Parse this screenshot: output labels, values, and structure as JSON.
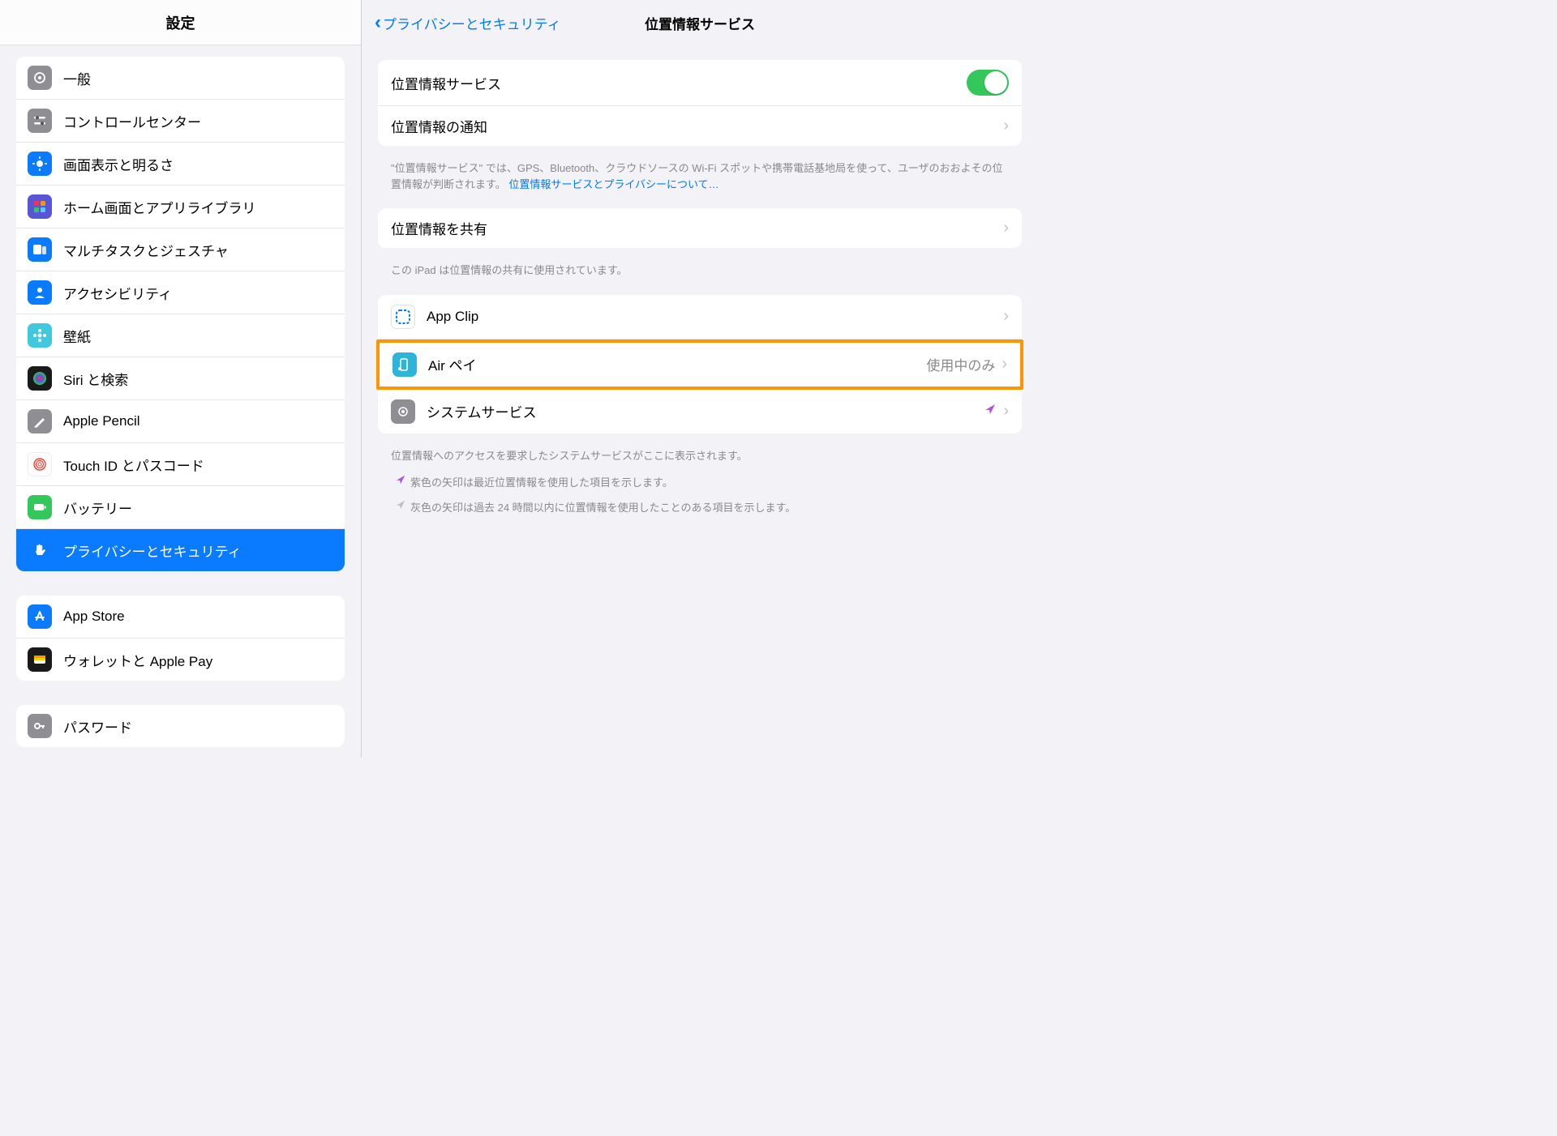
{
  "sidebar": {
    "title": "設定",
    "group1": [
      {
        "label": "一般",
        "color": "#8e8e93",
        "icon": "gear"
      },
      {
        "label": "コントロールセンター",
        "color": "#8e8e93",
        "icon": "sliders"
      },
      {
        "label": "画面表示と明るさ",
        "color": "#0a7aff",
        "icon": "sun"
      },
      {
        "label": "ホーム画面とアプリライブラリ",
        "color": "#5856d6",
        "icon": "grid"
      },
      {
        "label": "マルチタスクとジェスチャ",
        "color": "#0a7aff",
        "icon": "multitask"
      },
      {
        "label": "アクセシビリティ",
        "color": "#0a7aff",
        "icon": "person"
      },
      {
        "label": "壁紙",
        "color": "#3fc8de",
        "icon": "flower"
      },
      {
        "label": "Siri と検索",
        "color": "#1a1a1a",
        "icon": "siri"
      },
      {
        "label": "Apple Pencil",
        "color": "#8e8e93",
        "icon": "pencil"
      },
      {
        "label": "Touch ID とパスコード",
        "color": "#ffffff",
        "icon": "touchid"
      },
      {
        "label": "バッテリー",
        "color": "#34c759",
        "icon": "battery"
      },
      {
        "label": "プライバシーとセキュリティ",
        "color": "#0a7aff",
        "icon": "hand",
        "selected": true
      }
    ],
    "group2": [
      {
        "label": "App Store",
        "color": "#0a7aff",
        "icon": "appstore"
      },
      {
        "label": "ウォレットと Apple Pay",
        "color": "#1a1a1a",
        "icon": "wallet"
      }
    ],
    "group3": [
      {
        "label": "パスワード",
        "color": "#8e8e93",
        "icon": "key"
      }
    ]
  },
  "main": {
    "back": "プライバシーとセキュリティ",
    "title": "位置情報サービス",
    "rows1_a": "位置情報サービス",
    "rows1_b": "位置情報の通知",
    "foot1_text": "\"位置情報サービス\" では、GPS、Bluetooth、クラウドソースの Wi-Fi スポットや携帯電話基地局を使って、ユーザのおおよその位置情報が判断されます。 ",
    "foot1_link": "位置情報サービスとプライバシーについて…",
    "rows2_a": "位置情報を共有",
    "foot2": "この iPad は位置情報の共有に使用されています。",
    "apps": {
      "appclip": "App Clip",
      "airpay": "Air ペイ",
      "airpay_status": "使用中のみ",
      "system": "システムサービス"
    },
    "foot3": "位置情報へのアクセスを要求したシステムサービスがここに表示されます。",
    "legend1": "紫色の矢印は最近位置情報を使用した項目を示します。",
    "legend2": "灰色の矢印は過去 24 時間以内に位置情報を使用したことのある項目を示します。"
  }
}
